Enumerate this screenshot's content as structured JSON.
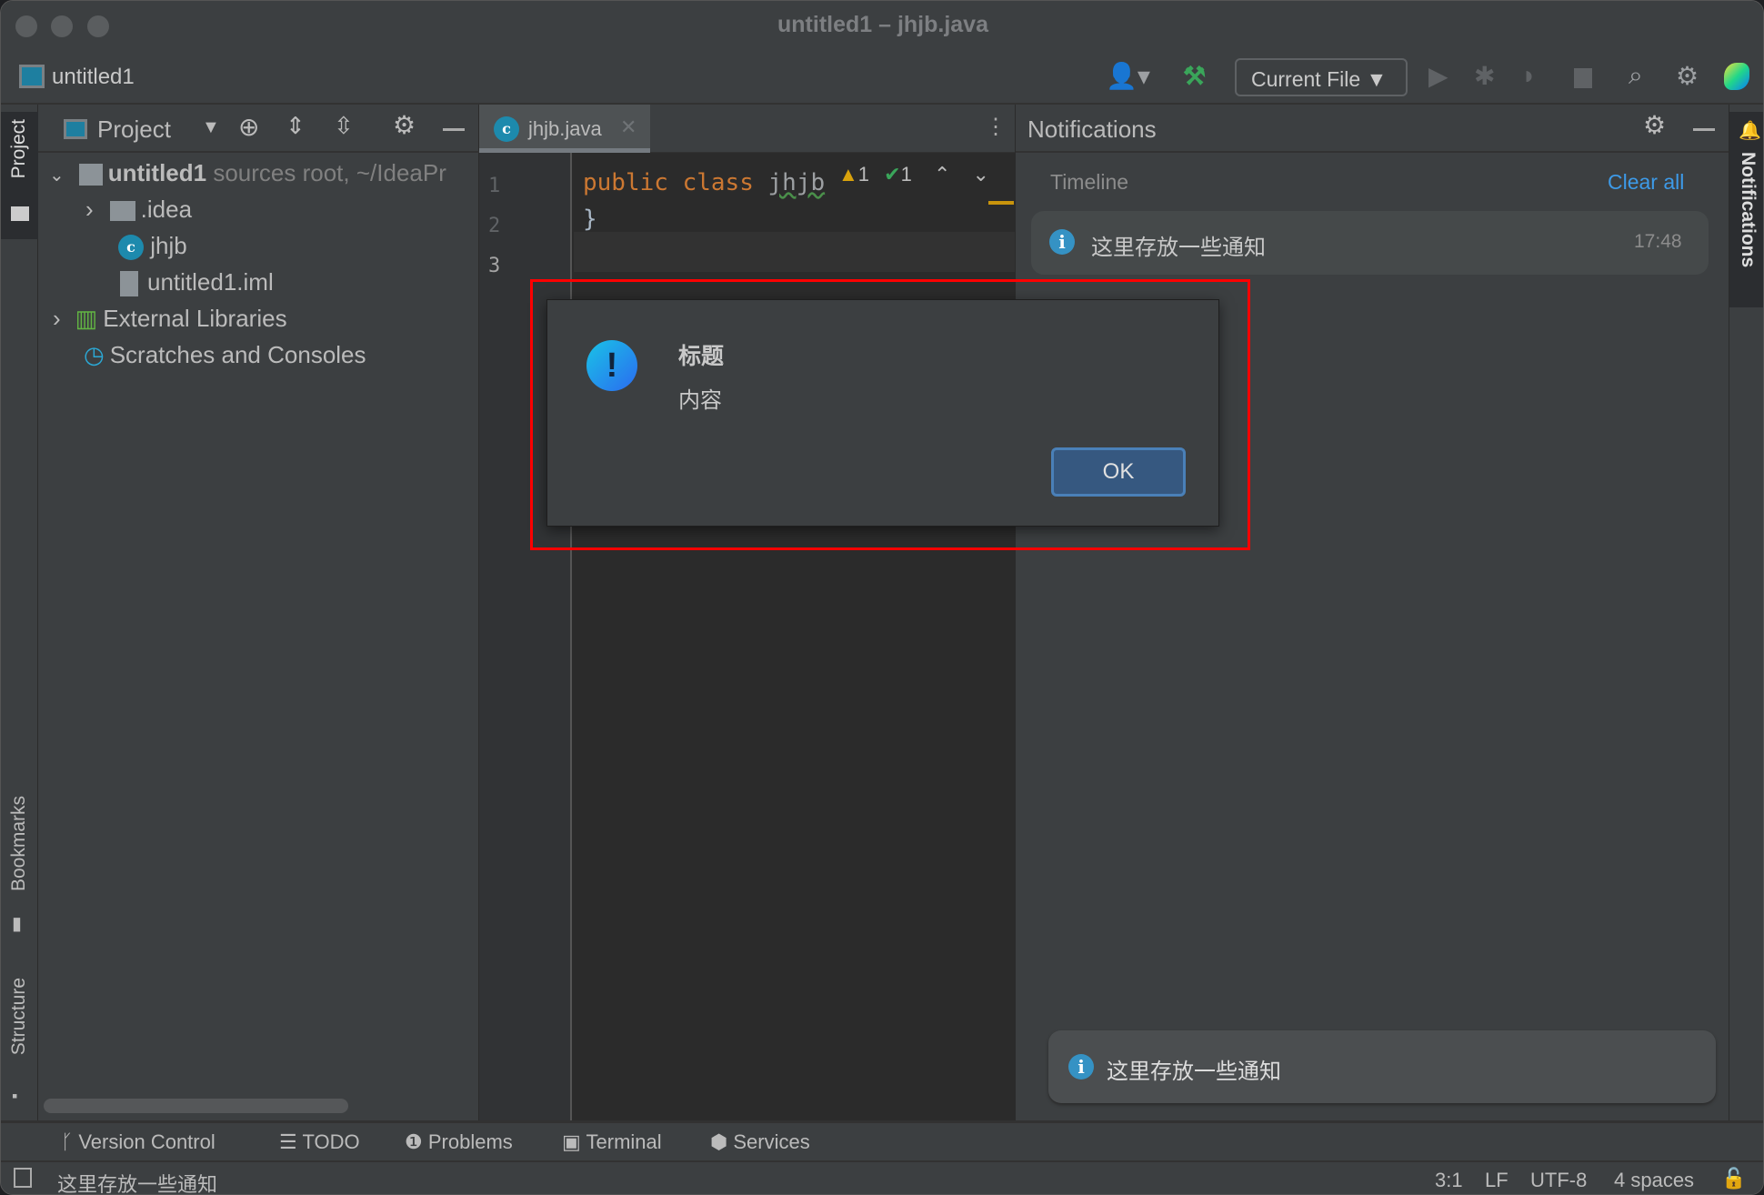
{
  "window": {
    "title": "untitled1 – jhjb.java"
  },
  "toolbar": {
    "project_name": "untitled1",
    "run_config": "Current File",
    "icons": [
      "user-icon",
      "build-hammer-icon",
      "run-icon",
      "debug-icon",
      "coverage-icon",
      "stop-icon",
      "search-icon",
      "settings-icon",
      "toolbox-logo-icon"
    ]
  },
  "left_strip": {
    "project": "Project",
    "bookmarks": "Bookmarks",
    "structure": "Structure"
  },
  "right_strip": {
    "notifications": "Notifications"
  },
  "project_panel": {
    "title": "Project",
    "tree": [
      {
        "label": "untitled1",
        "hint": "sources root, ~/IdeaPr",
        "expanded": true
      },
      {
        "label": ".idea",
        "expanded": false
      },
      {
        "label": "jhjb"
      },
      {
        "label": "untitled1.iml"
      },
      {
        "label": "External Libraries",
        "expanded": false
      },
      {
        "label": "Scratches and Consoles"
      }
    ]
  },
  "editor": {
    "tab": "jhjb.java",
    "lines": [
      "1",
      "2",
      "3"
    ],
    "code": {
      "kw1": "public",
      "kw2": "class",
      "name": "jhjb",
      "close": "}"
    },
    "inspections": {
      "warnings": "1",
      "ok": "1"
    }
  },
  "notifications": {
    "title": "Notifications",
    "timeline": "Timeline",
    "clear_all": "Clear all",
    "items": [
      {
        "text": "这里存放一些通知",
        "time": "17:48"
      }
    ],
    "balloon": "这里存放一些通知",
    "accent": "#3592c4"
  },
  "dialog": {
    "title": "标题",
    "message": "内容",
    "ok": "OK",
    "highlight_color": "#ff0000"
  },
  "bottom_tools": [
    "Version Control",
    "TODO",
    "Problems",
    "Terminal",
    "Services"
  ],
  "status": {
    "message": "这里存放一些通知",
    "position": "3:1",
    "line_sep": "LF",
    "encoding": "UTF-8",
    "indent": "4 spaces"
  }
}
